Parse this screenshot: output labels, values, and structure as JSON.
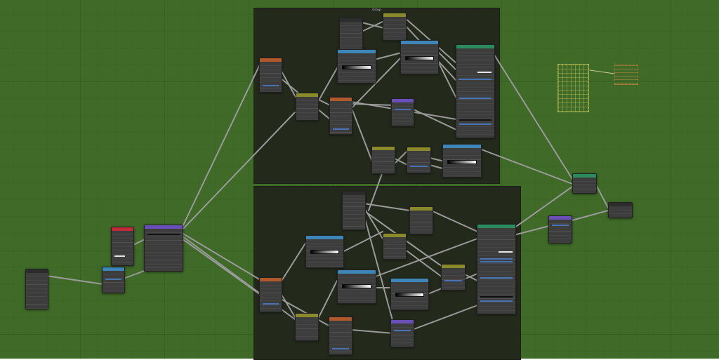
{
  "app": "node-editor",
  "frame_top_label": "Group",
  "colors": {
    "canvas": "#3f6a28",
    "frame": "#232a1c",
    "node_body": "#3d3d3d",
    "link": "#9a9a9a",
    "header_texture": "#b0582a",
    "header_shader": "#2c8a5f",
    "header_converter": "#3f86b8",
    "header_vector": "#6a4fb8",
    "header_input": "#8a8a2a",
    "header_output": "#c02a3a"
  },
  "nodes_note_icons": [
    "frame-icon"
  ]
}
